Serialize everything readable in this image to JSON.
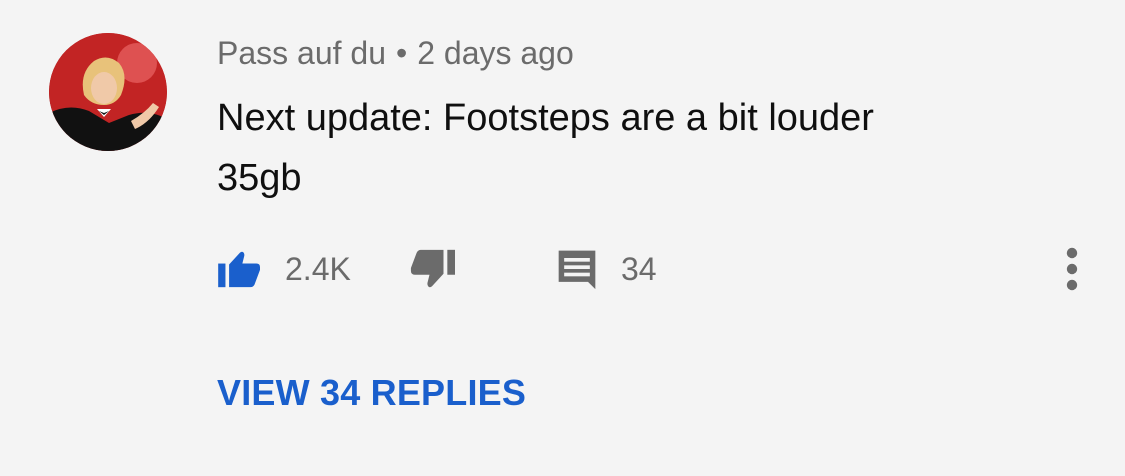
{
  "comment": {
    "author": "Pass auf du",
    "separator": "•",
    "timestamp": "2 days ago",
    "lines": [
      "Next update: Footsteps are a bit louder",
      "35gb"
    ],
    "likes": "2.4K",
    "reply_count": "34",
    "view_replies_label": "VIEW 34 REPLIES"
  },
  "icons": {
    "like": "thumbs-up-icon",
    "dislike": "thumbs-down-icon",
    "reply": "comment-icon",
    "more": "more-vert-icon"
  },
  "colors": {
    "background": "#f4f4f4",
    "accent": "#1a5fcc",
    "like_active": "#1a5fcc",
    "muted": "#6b6b6b",
    "text": "#0f0f0f"
  }
}
